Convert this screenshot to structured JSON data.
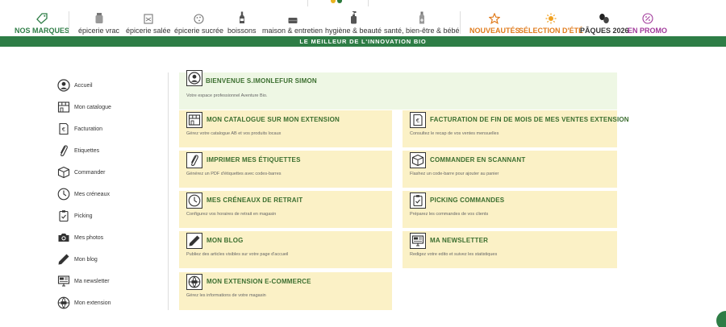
{
  "nav": {
    "items": [
      {
        "label": "NOS MARQUES",
        "color": "#2e7d46",
        "bold": true
      },
      {
        "label": "épicerie vrac"
      },
      {
        "label": "épicerie salée"
      },
      {
        "label": "épicerie sucrée"
      },
      {
        "label": "boissons"
      },
      {
        "label": "maison & entretien"
      },
      {
        "label": "hygiène & beauté"
      },
      {
        "label": "santé, bien-être & bébé"
      },
      {
        "label": "NOUVEAUTÉS",
        "color": "#e07b1c",
        "bold": true
      },
      {
        "label": "SÉLECTION D'ÉTÉ",
        "color": "#e07b1c",
        "bold": true
      },
      {
        "label": "PÂQUES 2026",
        "color": "#333333",
        "bold": true
      },
      {
        "label": "EN PROMO",
        "color": "#a0389a",
        "bold": true
      }
    ]
  },
  "banner": {
    "text": "LE MEILLEUR DE L'INNOVATION BIO"
  },
  "sidebar": {
    "items": [
      {
        "label": "Accueil"
      },
      {
        "label": "Mon catalogue"
      },
      {
        "label": "Facturation"
      },
      {
        "label": "Etiquettes"
      },
      {
        "label": "Commander"
      },
      {
        "label": "Mes créneaux"
      },
      {
        "label": "Picking"
      },
      {
        "label": "Mes photos"
      },
      {
        "label": "Mon blog"
      },
      {
        "label": "Ma newsletter"
      },
      {
        "label": "Mon extension"
      }
    ]
  },
  "welcome": {
    "title": "BIENVENUE S.IMONLEFUR SIMON",
    "desc": "Votre espace professionnel Aventure Bio."
  },
  "cards": [
    {
      "title": "MON CATALOGUE SUR MON EXTENSION",
      "desc": "Gérez votre catalogue AB et vos produits locaux"
    },
    {
      "title": "FACTURATION DE FIN DE MOIS DE MES VENTES EXTENSION",
      "desc": "Consultez le recap de vos ventes mensuelles"
    },
    {
      "title": "IMPRIMER MES ÉTIQUETTES",
      "desc": "Générez un PDF d'étiquettes avec codes-barres"
    },
    {
      "title": "COMMANDER EN SCANNANT",
      "desc": "Flashez un code-barre pour ajouter au panier"
    },
    {
      "title": "MES CRÉNEAUX DE RETRAIT",
      "desc": "Configurez vos horaires de retrait en magasin"
    },
    {
      "title": "PICKING COMMANDES",
      "desc": "Préparez les commandes de vos clients"
    },
    {
      "title": "MON BLOG",
      "desc": "Publiez des articles visibles sur votre page d'accueil"
    },
    {
      "title": "MA NEWSLETTER",
      "desc": "Redigez votre edito et suivez les statistiques"
    },
    {
      "title": "MON EXTENSION E-COMMERCE",
      "desc": "Gérez les informations de votre magasin"
    }
  ]
}
